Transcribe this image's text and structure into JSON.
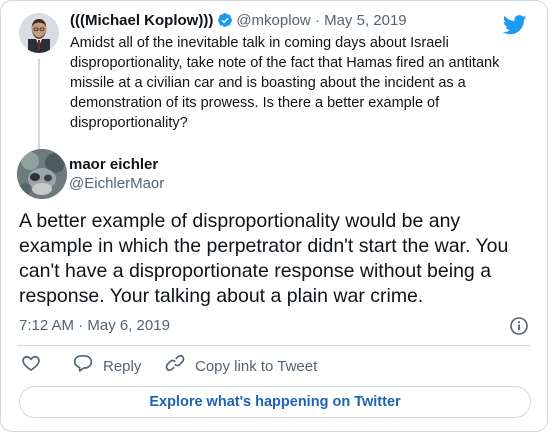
{
  "parent": {
    "author_name": "(((Michael Koplow)))",
    "handle": "@mkoplow",
    "separator": "·",
    "date": "May 5, 2019",
    "text": "Amidst all of the inevitable talk in coming days about Israeli disproportionality, take note of the fact that Hamas fired an antitank missile at a civilian car and is boasting about the incident as a demonstration of its prowess. Is there a better example of disproportionality?"
  },
  "reply": {
    "author_name": "maor eichler",
    "handle": "@EichlerMaor",
    "text": "A better example of disproportionality would be any example in which the perpetrator didn't start the war. You can't have a disproportionate response without being a response. Your talking about a plain war crime.",
    "timestamp": "7:12 AM · May 6, 2019"
  },
  "actions": {
    "reply_label": "Reply",
    "copy_link_label": "Copy link to Tweet"
  },
  "explore_label": "Explore what's happening on Twitter",
  "colors": {
    "twitter_blue": "#1d9bf0",
    "link_blue": "#1d64b0",
    "border": "#cfd9de",
    "secondary_text": "#536471"
  },
  "icons": [
    "twitter-bird-icon",
    "verified-badge-icon",
    "info-icon",
    "heart-icon",
    "reply-icon",
    "link-icon"
  ]
}
